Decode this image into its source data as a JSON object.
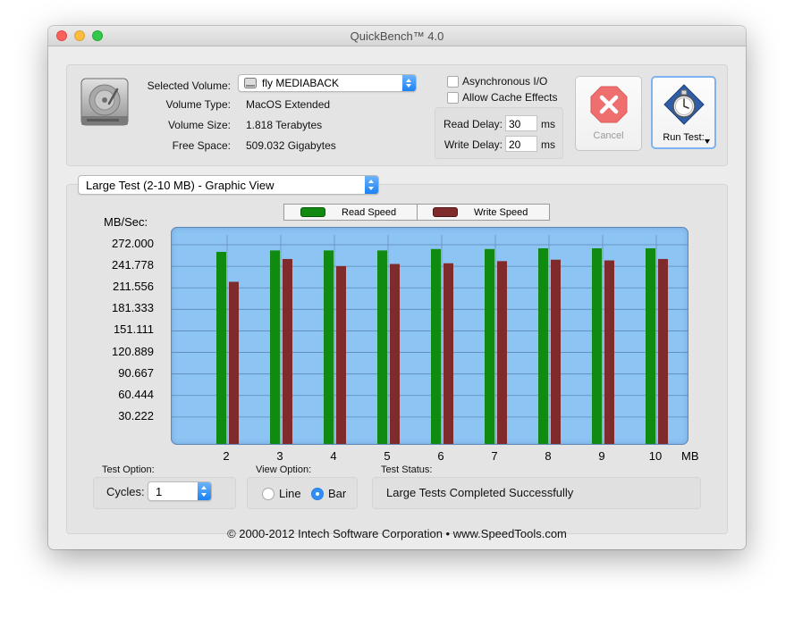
{
  "window": {
    "title": "QuickBench™ 4.0"
  },
  "volume": {
    "selected_label": "Selected Volume:",
    "selected_value": "fly MEDIABACK",
    "type_label": "Volume Type:",
    "type_value": "MacOS Extended",
    "size_label": "Volume Size:",
    "size_value": "1.818 Terabytes",
    "free_label": "Free Space:",
    "free_value": "509.032 Gigabytes"
  },
  "options": {
    "async_label": "Asynchronous I/O",
    "cache_label": "Allow Cache Effects",
    "read_delay_label": "Read Delay:",
    "read_delay_value": "30",
    "write_delay_label": "Write Delay:",
    "write_delay_value": "20",
    "ms_unit": "ms"
  },
  "buttons": {
    "cancel": "Cancel",
    "run": "Run Test:"
  },
  "view_select": "Large Test (2-10 MB) - Graphic View",
  "legend": {
    "read": "Read Speed",
    "write": "Write Speed"
  },
  "colors": {
    "read": "#118a11",
    "write": "#7f2b2b",
    "plot_bg": "#8cc4f4",
    "accent": "#1c82f3"
  },
  "chart_data": {
    "type": "bar",
    "ylabel": "MB/Sec:",
    "xunit": "MB",
    "yticks": [
      "272.000",
      "241.778",
      "211.556",
      "181.333",
      "151.111",
      "120.889",
      "90.667",
      "60.444",
      "30.222"
    ],
    "ylim": [
      0,
      272
    ],
    "categories": [
      "2",
      "3",
      "4",
      "5",
      "6",
      "7",
      "8",
      "9",
      "10"
    ],
    "series": [
      {
        "name": "Read Speed",
        "values": [
          262,
          264,
          264,
          264,
          266,
          266,
          267,
          267,
          267
        ]
      },
      {
        "name": "Write Speed",
        "values": [
          220,
          252,
          242,
          245,
          246,
          249,
          251,
          250,
          252
        ]
      }
    ],
    "grid": true,
    "legend_position": "top"
  },
  "test_option": {
    "label": "Test Option:",
    "cycles_label": "Cycles:",
    "cycles_value": "1"
  },
  "view_option": {
    "label": "View Option:",
    "line": "Line",
    "bar": "Bar",
    "selected": "Bar"
  },
  "test_status": {
    "label": "Test Status:",
    "value": "Large Tests Completed Successfully"
  },
  "footer": "© 2000-2012 Intech Software Corporation • www.SpeedTools.com"
}
